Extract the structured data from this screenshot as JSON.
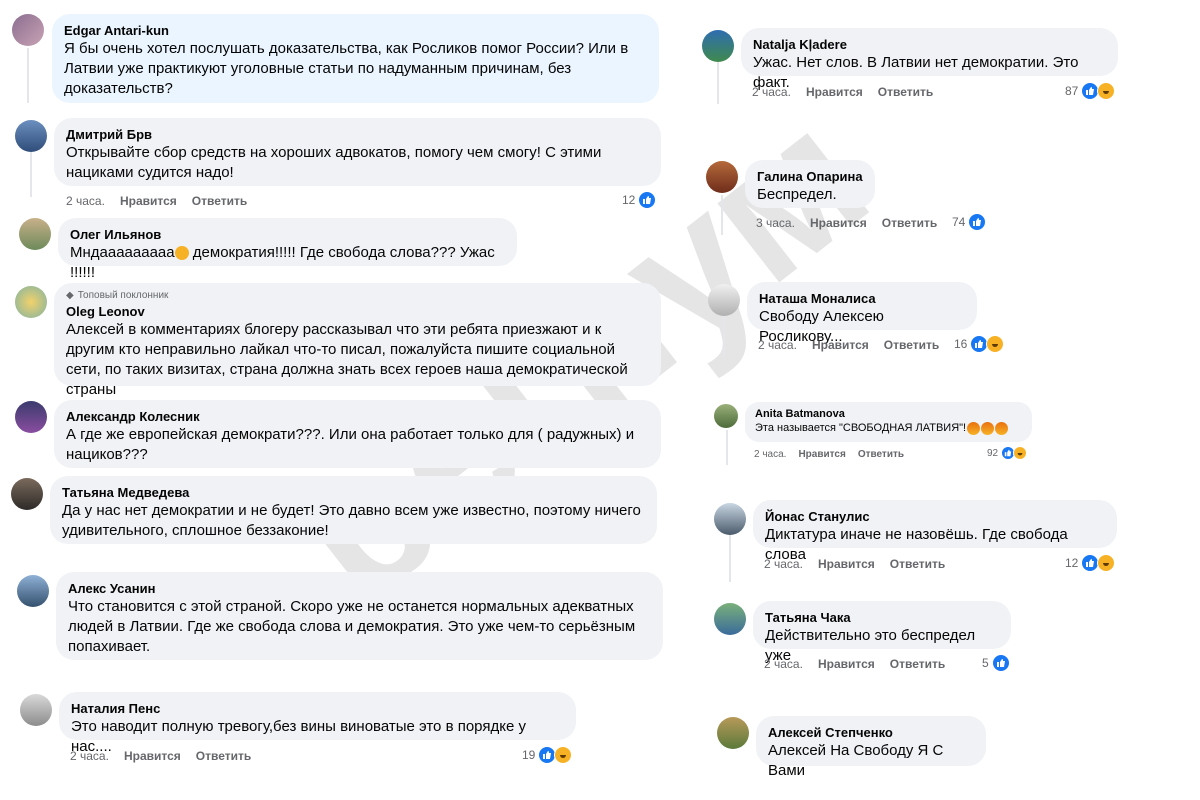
{
  "comments_left": [
    {
      "name": "Edgar Antari-kun",
      "text": "Я бы очень хотел послушать доказательства, как Росликов помог России? Или в Латвии уже практикуют уголовные статьи по надуманным причинам, без доказательств?"
    },
    {
      "name": "Дмитрий Брв",
      "text": "Открывайте сбор средств на хороших адвокатов, помогу чем смогу! С этими нациками судится надо!",
      "time": "2 часа.",
      "like": "Нравится",
      "reply": "Ответить",
      "count": "12"
    },
    {
      "name": "Олег Ильянов",
      "text": "Мндааааааааа",
      "text2": "демократия!!!!! Где свобода слова??? Ужас !!!!!!"
    },
    {
      "badge": "Топовый поклонник",
      "name": "Oleg Leonov",
      "text": "Алексей в комментариях блогеру рассказывал что эти ребята приезжают и к другим кто неправильно лайкал что-то писал, пожалуйста пишите социальной сети, по таких визитах, страна должна знать всех героев наша демократической страны"
    },
    {
      "name": "Александр Колесник",
      "text": "А где же европейская демократи???. Или она работает только для ( радужных) и нациков???"
    },
    {
      "name": "Татьяна Медведева",
      "text": "Да у нас нет демократии и не будет! Это давно всем уже известно, поэтому ничего удивительного, сплошное беззаконие!"
    },
    {
      "name": "Алекс Усанин",
      "text": "Что становится с этой страной. Скоро уже не останется нормальных адекватных людей в Латвии. Где же свобода слова и демократия. Это уже чем-то серьёзным попахивает."
    },
    {
      "name": "Наталия Пенс",
      "text": "Это наводит полную тревогу,без вины виноватые это в порядке у нас....",
      "time": "2 часа.",
      "like": "Нравится",
      "reply": "Ответить",
      "count": "19"
    }
  ],
  "comments_right": [
    {
      "name": "Natalja Kļadere",
      "text": "Ужас. Нет слов. В Латвии нет демократии. Это факт.",
      "time": "2 часа.",
      "like": "Нравится",
      "reply": "Ответить",
      "count": "87"
    },
    {
      "name": "Галина Опарина",
      "text": "Беспредел.",
      "time": "3 часа.",
      "like": "Нравится",
      "reply": "Ответить",
      "count": "74"
    },
    {
      "name": "Наташа Моналиса",
      "text": "Свободу Алексею Росликову...",
      "time": "2 часа.",
      "like": "Нравится",
      "reply": "Ответить",
      "count": "16"
    },
    {
      "name": "Anita Batmanova",
      "text": "Эта называется \"СВОБОДНАЯ ЛАТВИЯ\"!",
      "time": "2 часа.",
      "like": "Нравится",
      "reply": "Ответить",
      "count": "92"
    },
    {
      "name": "Йонас Станулис",
      "text": "Диктатура иначе не назовёшь. Где свобода слова",
      "time": "2 часа.",
      "like": "Нравится",
      "reply": "Ответить",
      "count": "12"
    },
    {
      "name": "Татьяна Чака",
      "text": "Действительно это беспредел уже",
      "time": "2 часа.",
      "like": "Нравится",
      "reply": "Ответить",
      "count": "5"
    },
    {
      "name": "Алексей Степченко",
      "text": "Алексей На Свободу Я С Вами"
    }
  ],
  "watermark": "регнум",
  "colors": {
    "bubble": "#f0f2f5",
    "bubble_highlight": "#ebf5ff",
    "like": "#1877f2",
    "haha": "#f7b125",
    "meta": "#65676b"
  }
}
